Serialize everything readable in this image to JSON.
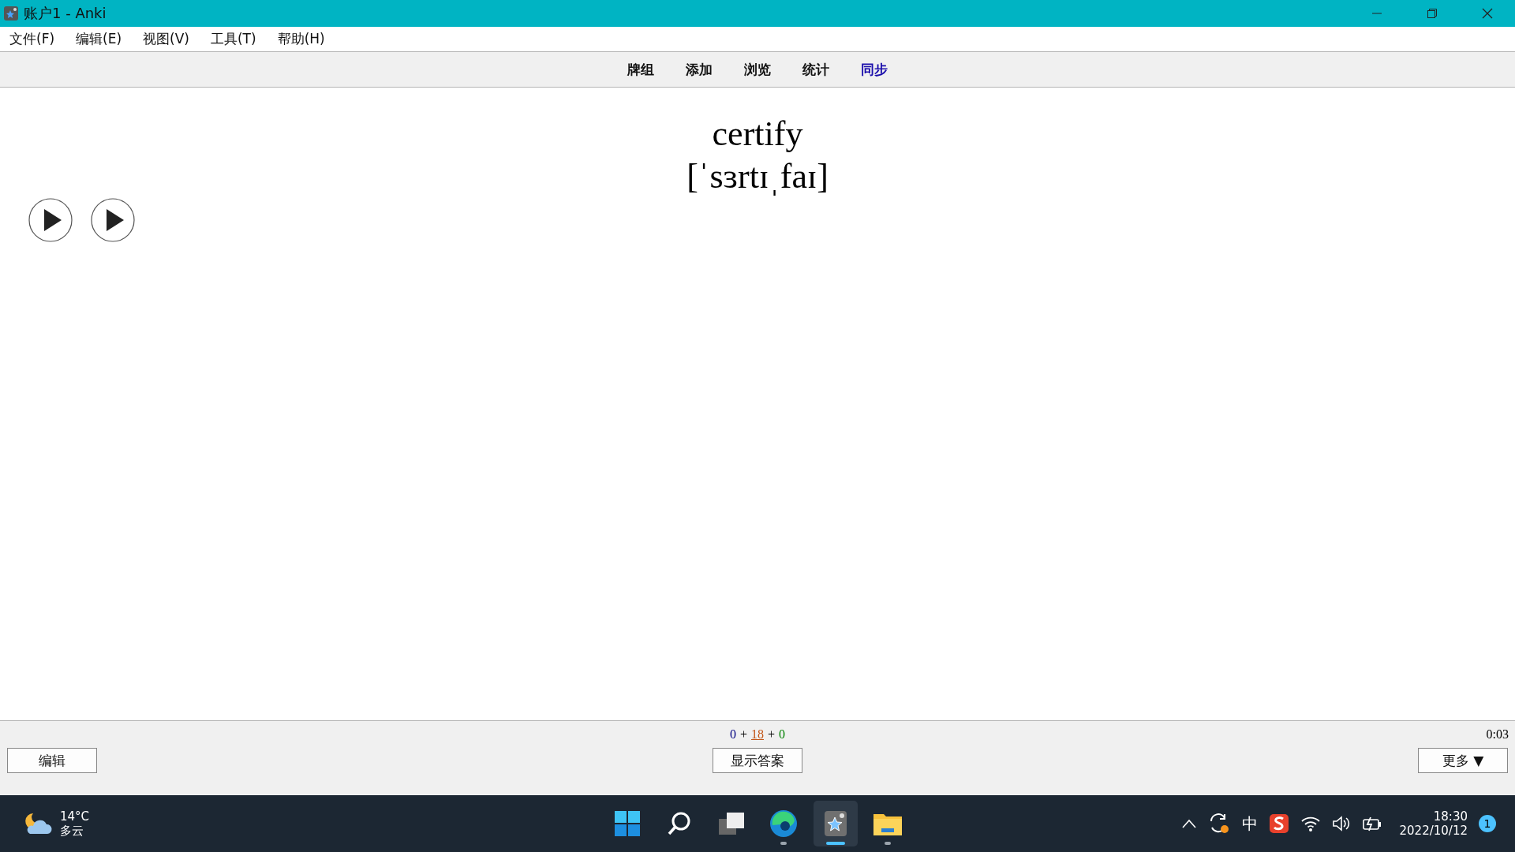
{
  "window": {
    "title": "账户1 - Anki"
  },
  "menu": [
    "文件(F)",
    "编辑(E)",
    "视图(V)",
    "工具(T)",
    "帮助(H)"
  ],
  "toolbar": [
    {
      "label": "牌组",
      "highlighted": false
    },
    {
      "label": "添加",
      "highlighted": false
    },
    {
      "label": "浏览",
      "highlighted": false
    },
    {
      "label": "统计",
      "highlighted": false
    },
    {
      "label": "同步",
      "highlighted": true
    }
  ],
  "card": {
    "word": "certify",
    "phonetic": "[ˈsɜrtɪˌfaɪ]",
    "audio_buttons": [
      {
        "kind": "play"
      },
      {
        "kind": "play"
      }
    ]
  },
  "counts": [
    {
      "kind": "count",
      "text": "0",
      "color": "#000080",
      "current": false
    },
    {
      "kind": "sep",
      "text": "+"
    },
    {
      "kind": "count",
      "text": "18",
      "color": "#c35617",
      "current": true
    },
    {
      "kind": "sep",
      "text": "+"
    },
    {
      "kind": "count",
      "text": "0",
      "color": "#008000",
      "current": false
    }
  ],
  "timer": "0:03",
  "buttons": {
    "edit": "编辑",
    "show_answer": "显示答案",
    "more": "更多 ▼"
  },
  "taskbar": {
    "weather": {
      "temp": "14°C",
      "condition": "多云"
    },
    "apps": [
      {
        "kind": "start",
        "running": false,
        "active": false
      },
      {
        "kind": "search",
        "running": false,
        "active": false
      },
      {
        "kind": "taskview",
        "running": false,
        "active": false
      },
      {
        "kind": "browser",
        "running": true,
        "active": false
      },
      {
        "kind": "anki",
        "running": true,
        "active": true
      },
      {
        "kind": "files",
        "running": true,
        "active": false
      }
    ],
    "ime": "中",
    "time": "18:30",
    "date": "2022/10/12",
    "notifications": "1"
  }
}
